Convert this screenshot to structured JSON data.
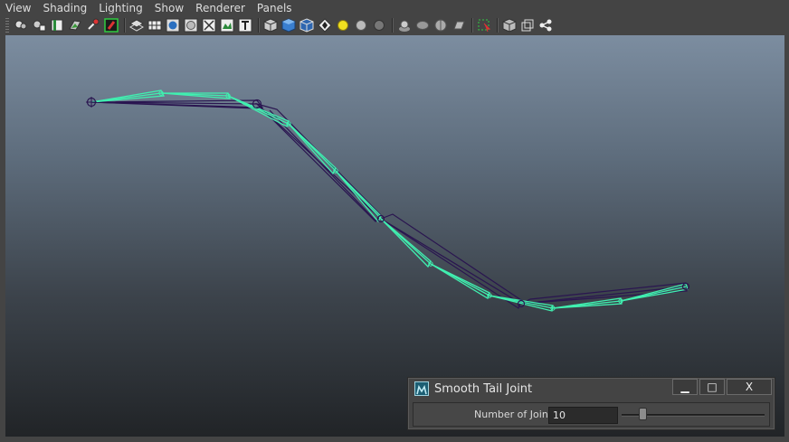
{
  "menubar": {
    "items": [
      "View",
      "Shading",
      "Lighting",
      "Show",
      "Renderer",
      "Panels"
    ]
  },
  "toolbar": {
    "icons": [
      "select-camera-icon",
      "camera-attributes-icon",
      "bookmark-icon",
      "image-plane-icon",
      "two-d-pan-zoom-icon",
      "grease-pencil-icon",
      "wireframe-on-shaded-icon",
      "xray-grid-icon",
      "smooth-shade-icon",
      "wireframe-icon",
      "isolate-select-icon",
      "texture-icon",
      "text-icon",
      "default-material-icon",
      "flat-shade-icon",
      "shaded-cube-icon",
      "checker-texture-icon",
      "use-default-light-icon",
      "shadows-icon",
      "ambient-occlusion-icon",
      "motion-blur-icon",
      "anti-aliasing-icon",
      "depth-of-field-icon",
      "screen-space-icon",
      "selection-highlight-icon",
      "xray-icon",
      "xray-active-icon",
      "xray-joints-icon"
    ]
  },
  "dialog": {
    "title": "Smooth Tail Joint",
    "minimize_label": "▁",
    "maximize_label": "□",
    "close_label": "X",
    "field_label": "Number of Joint",
    "field_value": "10",
    "slider_fraction": 0.13
  },
  "colors": {
    "viewport_top": "#7c8da0",
    "viewport_bottom": "#212427",
    "joint_curve": "#40f0b0",
    "bone_outline": "#2a1550"
  }
}
